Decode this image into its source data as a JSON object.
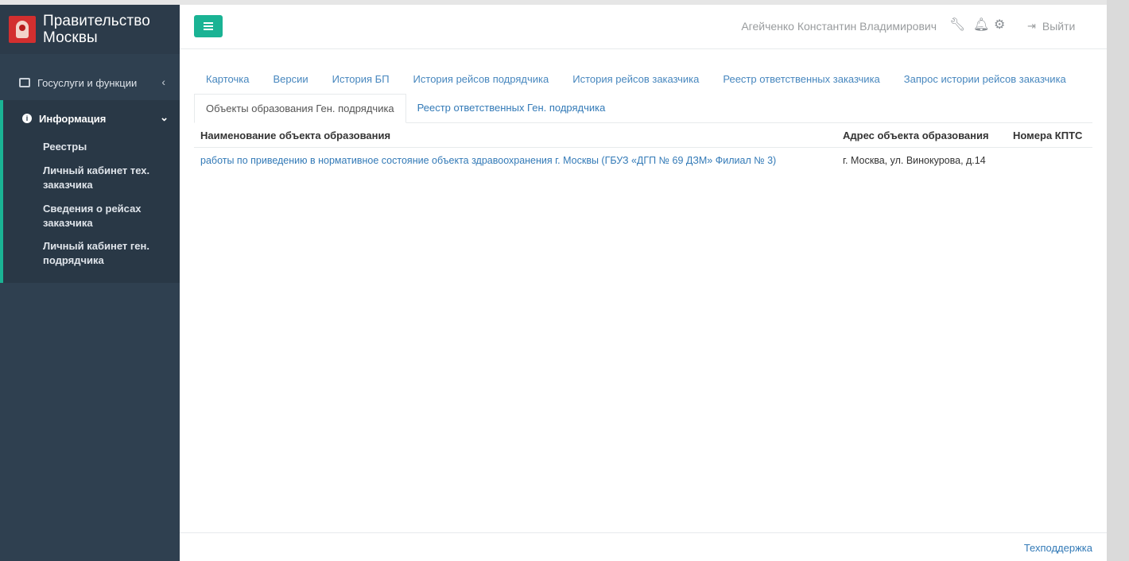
{
  "brand": {
    "title": "Правительство Москвы"
  },
  "sidebar": {
    "items": [
      {
        "label": "Госуслуги и функции"
      },
      {
        "label": "Информация"
      }
    ],
    "sub_items": [
      {
        "label": "Реестры"
      },
      {
        "label": "Личный кабинет тех. заказчика"
      },
      {
        "label": "Сведения о рейсах заказчика"
      },
      {
        "label": "Личный кабинет ген. подрядчика"
      }
    ]
  },
  "header": {
    "user_name": "Агейченко Константин Владимирович",
    "logout_label": "Выйти"
  },
  "tabs": {
    "row1": [
      {
        "label": "Карточка"
      },
      {
        "label": "Версии"
      },
      {
        "label": "История БП"
      },
      {
        "label": "История рейсов подрядчика"
      },
      {
        "label": "История рейсов заказчика"
      },
      {
        "label": "Реестр ответственных заказчика"
      },
      {
        "label": "Запрос истории рейсов заказчика"
      }
    ],
    "row2": [
      {
        "label": "Объекты образования Ген. подрядчика",
        "active": true
      },
      {
        "label": "Реестр ответственных Ген. подрядчика"
      }
    ]
  },
  "table": {
    "columns": [
      "Наименование объекта образования",
      "Адрес объекта образования",
      "Номера КПТС"
    ],
    "rows": [
      {
        "name": "работы по приведению в нормативное состояние объекта здравоохранения г. Москвы (ГБУЗ «ДГП № 69 ДЗМ» Филиал № 3)",
        "address": "г. Москва, ул. Винокурова, д.14",
        "kpts": ""
      }
    ]
  },
  "footer": {
    "support_label": "Техподдержка"
  },
  "colors": {
    "accent": "#1ab394",
    "sidebar": "#2f4050",
    "link": "#337ab7"
  }
}
